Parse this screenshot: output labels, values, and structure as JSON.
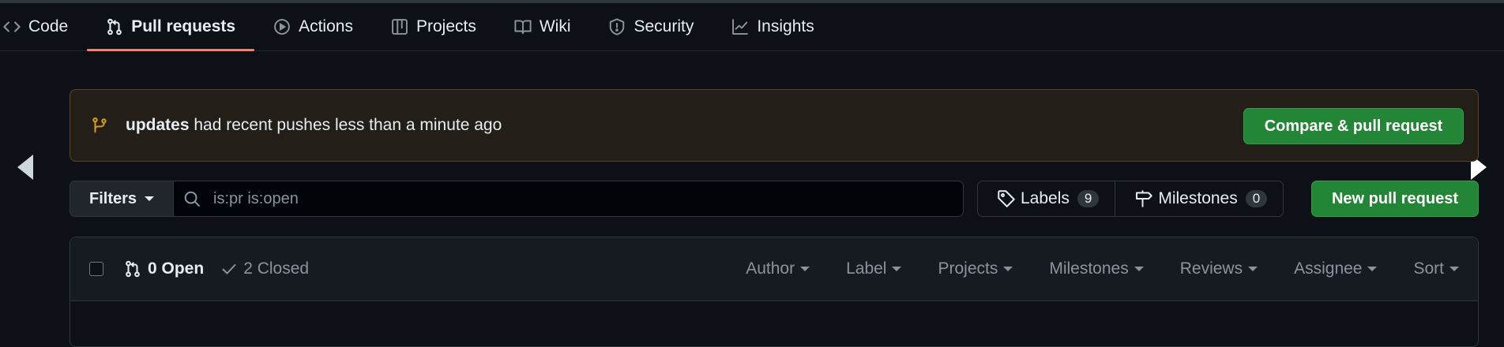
{
  "tabs": [
    {
      "label": "Code",
      "icon": "code-icon"
    },
    {
      "label": "Pull requests",
      "icon": "git-pull-request-icon"
    },
    {
      "label": "Actions",
      "icon": "play-icon"
    },
    {
      "label": "Projects",
      "icon": "table-icon"
    },
    {
      "label": "Wiki",
      "icon": "book-icon"
    },
    {
      "label": "Security",
      "icon": "shield-icon"
    },
    {
      "label": "Insights",
      "icon": "graph-icon"
    }
  ],
  "banner": {
    "branch": "updates",
    "message": " had recent pushes less than a minute ago",
    "button": "Compare & pull request"
  },
  "filters": {
    "button": "Filters",
    "search_value": "is:pr is:open"
  },
  "labels": {
    "label": "Labels",
    "count": "9"
  },
  "milestones": {
    "label": "Milestones",
    "count": "0"
  },
  "new_pr": "New pull request",
  "list": {
    "open": "0 Open",
    "closed": "2 Closed",
    "sorts": [
      "Author",
      "Label",
      "Projects",
      "Milestones",
      "Reviews",
      "Assignee",
      "Sort"
    ]
  },
  "colors": {
    "background": "#0d1117",
    "accent_tab": "#f78166",
    "green_button": "#238636",
    "banner_bg": "#231f18",
    "banner_icon": "#d29922"
  }
}
